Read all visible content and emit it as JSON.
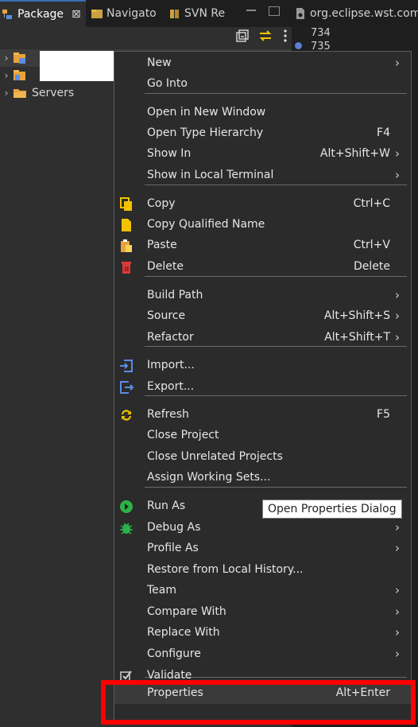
{
  "tabs": [
    {
      "label": "Package",
      "close": "⊠"
    },
    {
      "label": "Navigato"
    },
    {
      "label": "SVN Re"
    },
    {
      "label": "org.eclipse.wst.com"
    }
  ],
  "editor": {
    "line_numbers": [
      "734",
      "735"
    ]
  },
  "tree": {
    "items": [
      {
        "label": ""
      },
      {
        "label": ""
      },
      {
        "label": "Servers"
      }
    ]
  },
  "menu": {
    "items": [
      {
        "label": "New",
        "shortcut": "",
        "submenu": true,
        "icon": ""
      },
      {
        "label": "Go Into",
        "shortcut": "",
        "submenu": false,
        "icon": ""
      },
      {
        "label": "Open in New Window",
        "shortcut": "",
        "submenu": false,
        "icon": ""
      },
      {
        "label": "Open Type Hierarchy",
        "shortcut": "F4",
        "submenu": false,
        "icon": ""
      },
      {
        "label": "Show In",
        "shortcut": "Alt+Shift+W",
        "submenu": true,
        "icon": ""
      },
      {
        "label": "Show in Local Terminal",
        "shortcut": "",
        "submenu": true,
        "icon": ""
      },
      {
        "label": "Copy",
        "shortcut": "Ctrl+C",
        "submenu": false,
        "icon": "copy-icon"
      },
      {
        "label": "Copy Qualified Name",
        "shortcut": "",
        "submenu": false,
        "icon": "copy-qualified-name-icon"
      },
      {
        "label": "Paste",
        "shortcut": "Ctrl+V",
        "submenu": false,
        "icon": "paste-icon"
      },
      {
        "label": "Delete",
        "shortcut": "Delete",
        "submenu": false,
        "icon": "delete-icon"
      },
      {
        "label": "Build Path",
        "shortcut": "",
        "submenu": true,
        "icon": ""
      },
      {
        "label": "Source",
        "shortcut": "Alt+Shift+S",
        "submenu": true,
        "icon": ""
      },
      {
        "label": "Refactor",
        "shortcut": "Alt+Shift+T",
        "submenu": true,
        "icon": ""
      },
      {
        "label": "Import...",
        "shortcut": "",
        "submenu": false,
        "icon": "import-icon"
      },
      {
        "label": "Export...",
        "shortcut": "",
        "submenu": false,
        "icon": "export-icon"
      },
      {
        "label": "Refresh",
        "shortcut": "F5",
        "submenu": false,
        "icon": "refresh-icon"
      },
      {
        "label": "Close Project",
        "shortcut": "",
        "submenu": false,
        "icon": ""
      },
      {
        "label": "Close Unrelated Projects",
        "shortcut": "",
        "submenu": false,
        "icon": ""
      },
      {
        "label": "Assign Working Sets...",
        "shortcut": "",
        "submenu": false,
        "icon": ""
      },
      {
        "label": "Run As",
        "shortcut": "",
        "submenu": true,
        "icon": "run-icon"
      },
      {
        "label": "Debug As",
        "shortcut": "",
        "submenu": true,
        "icon": "debug-bug-icon"
      },
      {
        "label": "Profile As",
        "shortcut": "",
        "submenu": true,
        "icon": ""
      },
      {
        "label": "Restore from Local History...",
        "shortcut": "",
        "submenu": false,
        "icon": ""
      },
      {
        "label": "Team",
        "shortcut": "",
        "submenu": true,
        "icon": ""
      },
      {
        "label": "Compare With",
        "shortcut": "",
        "submenu": true,
        "icon": ""
      },
      {
        "label": "Replace With",
        "shortcut": "",
        "submenu": true,
        "icon": ""
      },
      {
        "label": "Configure",
        "shortcut": "",
        "submenu": true,
        "icon": ""
      },
      {
        "label": "Validate",
        "shortcut": "",
        "submenu": false,
        "icon": "validate-check-icon"
      },
      {
        "label": "Properties",
        "shortcut": "Alt+Enter",
        "submenu": false,
        "icon": ""
      }
    ],
    "submenu_arrow": "›",
    "tooltip": "Open Properties Dialog"
  },
  "colors": {
    "highlight": "#ff0000",
    "run_green": "#2bb34a",
    "copy_yellow": "#f2c200",
    "delete_red": "#d83a3a",
    "import_blue": "#5a8de6"
  }
}
